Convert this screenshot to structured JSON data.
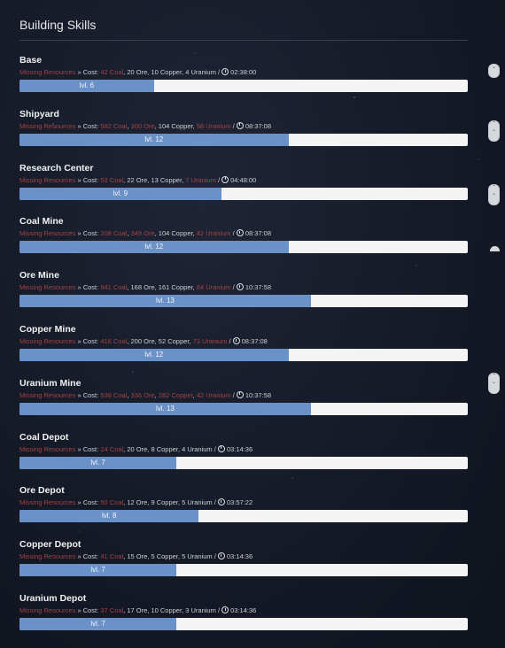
{
  "title": "Building Skills",
  "missing_label": "Missing Resources",
  "cost_label": "» Cost:",
  "buildings": [
    {
      "name": "Base",
      "coal": "42 Coal",
      "coal_missing": true,
      "ore": "20 Ore",
      "ore_missing": false,
      "copper": "10 Copper",
      "copper_missing": false,
      "uranium": "4 Uranium",
      "uranium_missing": false,
      "time": "02:38:00",
      "level_label": "lvl. 6",
      "progress": 0.3
    },
    {
      "name": "Shipyard",
      "coal": "582 Coal",
      "coal_missing": true,
      "ore": "300 Ore",
      "ore_missing": true,
      "copper": "104 Copper",
      "copper_missing": false,
      "uranium": "58 Uranium",
      "uranium_missing": true,
      "time": "08:37:08",
      "level_label": "lvl. 12",
      "progress": 0.6
    },
    {
      "name": "Research Center",
      "coal": "53 Coal",
      "coal_missing": true,
      "ore": "22 Ore",
      "ore_missing": false,
      "copper": "13 Copper",
      "copper_missing": false,
      "uranium": "7 Uranium",
      "uranium_missing": true,
      "time": "04:48:00",
      "level_label": "lvl. 9",
      "progress": 0.45
    },
    {
      "name": "Coal Mine",
      "coal": "208 Coal",
      "coal_missing": true,
      "ore": "349 Ore",
      "ore_missing": true,
      "copper": "104 Copper",
      "copper_missing": false,
      "uranium": "42 Uranium",
      "uranium_missing": true,
      "time": "08:37:08",
      "level_label": "lvl. 12",
      "progress": 0.6
    },
    {
      "name": "Ore Mine",
      "coal": "941 Coal",
      "coal_missing": true,
      "ore": "168 Ore",
      "ore_missing": false,
      "copper": "161 Copper",
      "copper_missing": false,
      "uranium": "84 Uranium",
      "uranium_missing": true,
      "time": "10:37:58",
      "level_label": "lvl. 13",
      "progress": 0.65
    },
    {
      "name": "Copper Mine",
      "coal": "416 Coal",
      "coal_missing": true,
      "ore": "200 Ore",
      "ore_missing": false,
      "copper": "52 Copper",
      "copper_missing": false,
      "uranium": "73 Uranium",
      "uranium_missing": true,
      "time": "08:37:08",
      "level_label": "lvl. 12",
      "progress": 0.6
    },
    {
      "name": "Uranium Mine",
      "coal": "538 Coal",
      "coal_missing": true,
      "ore": "336 Ore",
      "ore_missing": true,
      "copper": "282 Copper",
      "copper_missing": true,
      "uranium": "42 Uranium",
      "uranium_missing": true,
      "time": "10:37:58",
      "level_label": "lvl. 13",
      "progress": 0.65
    },
    {
      "name": "Coal Depot",
      "coal": "24 Coal",
      "coal_missing": true,
      "ore": "20 Ore",
      "ore_missing": false,
      "copper": "8 Copper",
      "copper_missing": false,
      "uranium": "4 Uranium",
      "uranium_missing": false,
      "time": "03:14:36",
      "level_label": "lvl. 7",
      "progress": 0.35
    },
    {
      "name": "Ore Depot",
      "coal": "50 Coal",
      "coal_missing": true,
      "ore": "12 Ore",
      "ore_missing": false,
      "copper": "9 Copper",
      "copper_missing": false,
      "uranium": "5 Uranium",
      "uranium_missing": false,
      "time": "03:57:22",
      "level_label": "lvl. 8",
      "progress": 0.4
    },
    {
      "name": "Copper Depot",
      "coal": "41 Coal",
      "coal_missing": true,
      "ore": "15 Ore",
      "ore_missing": false,
      "copper": "5 Copper",
      "copper_missing": false,
      "uranium": "5 Uranium",
      "uranium_missing": false,
      "time": "03:14:36",
      "level_label": "lvl. 7",
      "progress": 0.35
    },
    {
      "name": "Uranium Depot",
      "coal": "37 Coal",
      "coal_missing": true,
      "ore": "17 Ore",
      "ore_missing": false,
      "copper": "10 Copper",
      "copper_missing": false,
      "uranium": "3 Uranium",
      "uranium_missing": false,
      "time": "03:14:36",
      "level_label": "lvl. 7",
      "progress": 0.35
    }
  ],
  "colors": {
    "progress_fill": "#6b92c8",
    "progress_track": "#f4f4f4",
    "missing_text": "#a34343"
  }
}
